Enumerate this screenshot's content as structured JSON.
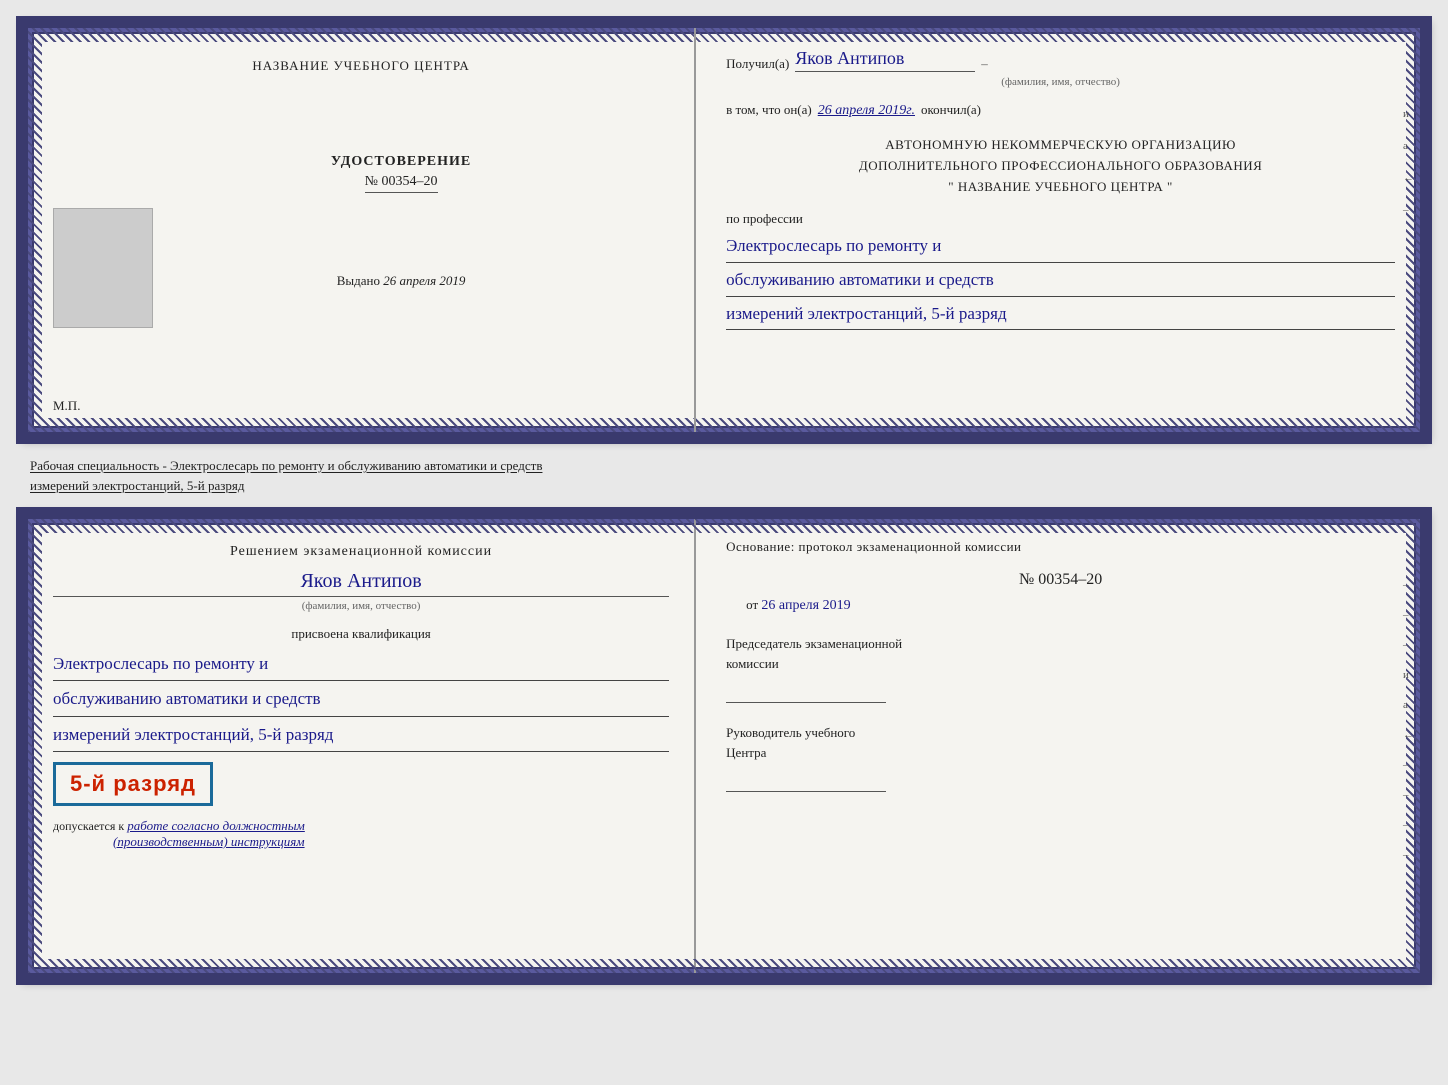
{
  "top_left": {
    "center_name": "НАЗВАНИЕ УЧЕБНОГО ЦЕНТРА",
    "udostoverenie_title": "УДОСТОВЕРЕНИЕ",
    "number": "№ 00354–20",
    "vydano_label": "Выдано",
    "vydano_date": "26 апреля 2019",
    "mp_label": "М.П."
  },
  "top_right": {
    "poluchil_label": "Получил(а)",
    "name_hw": "Яков Антипов",
    "dash": "–",
    "fio_caption": "(фамилия, имя, отчество)",
    "vtom_label": "в том, что он(а)",
    "date_hw": "26 апреля 2019г.",
    "okonchil": "окончил(а)",
    "org_line1": "АВТОНОМНУЮ НЕКОММЕРЧЕСКУЮ ОРГАНИЗАЦИЮ",
    "org_line2": "ДОПОЛНИТЕЛЬНОГО ПРОФЕССИОНАЛЬНОГО ОБРАЗОВАНИЯ",
    "org_line3": "\"  НАЗВАНИЕ УЧЕБНОГО ЦЕНТРА  \"",
    "po_professii": "по профессии",
    "profession_line1": "Электрослесарь по ремонту и",
    "profession_line2": "обслуживанию автоматики и средств",
    "profession_line3": "измерений электростанций, 5-й разряд",
    "right_labels": [
      "и",
      "а",
      "←",
      "–"
    ]
  },
  "middle_text": "Рабочая специальность - Электрослесарь по ремонту и обслуживанию автоматики и средств\nизмерений электростанций, 5-й разряд",
  "bottom_left": {
    "resheniem": "Решением экзаменационной комиссии",
    "name_hw": "Яков Антипов",
    "fio_caption": "(фамилия, имя, отчество)",
    "prisvoena": "присвоена квалификация",
    "qual_line1": "Электрослесарь по ремонту и",
    "qual_line2": "обслуживанию автоматики и средств",
    "qual_line3": "измерений электростанций, 5-й разряд",
    "razryad_stamp": "5-й разряд",
    "dopuskaetsya": "допускается к",
    "dopusk_hw": "работе согласно должностным",
    "dopusk_hw2": "(производственным) инструкциям"
  },
  "bottom_right": {
    "osnovanie_title": "Основание: протокол экзаменационной комиссии",
    "protocol_number": "№  00354–20",
    "ot_label": "от",
    "ot_date_hw": "26 апреля 2019",
    "chairman_title": "Председатель экзаменационной\nкомиссии",
    "rukovoditel_title": "Руководитель учебного\nЦентра",
    "right_labels": [
      "–",
      "–",
      "–",
      "и",
      "а",
      "←",
      "–",
      "–",
      "–",
      "–"
    ]
  }
}
